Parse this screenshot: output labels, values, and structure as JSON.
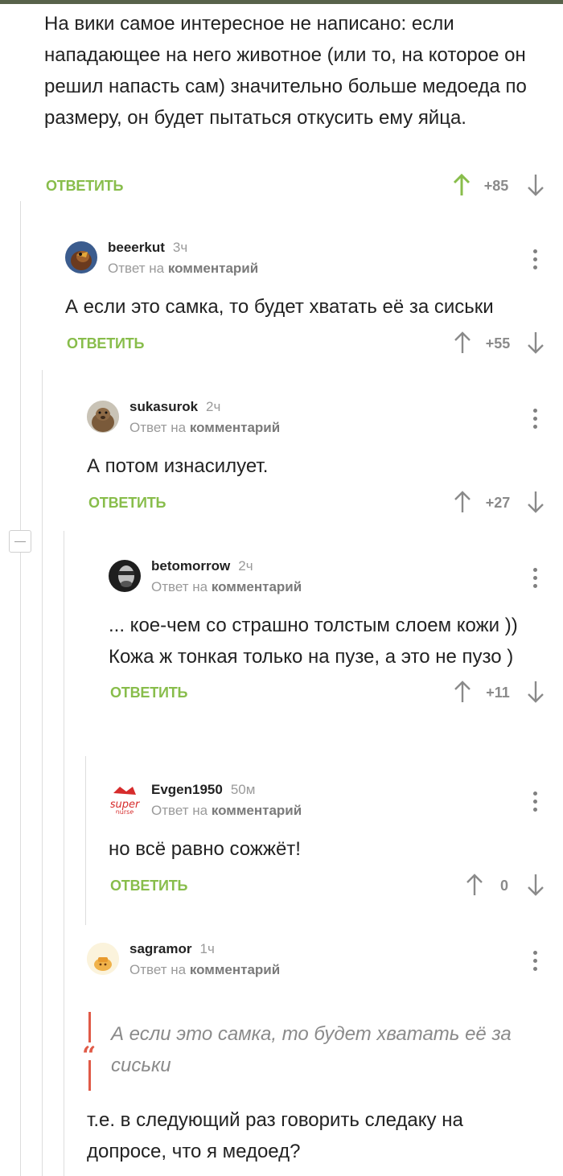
{
  "colors": {
    "accent": "#88bd4b",
    "quote": "#e05a47",
    "meta": "#9a9a9a"
  },
  "labels": {
    "reply_to": "Ответ на",
    "comment_word": "комментарий",
    "reply_button": "ОТВЕТИТЬ"
  },
  "top_comment": {
    "text": "На вики самое интересное не написано:  если нападающее на него животное (или то, на которое он решил напасть сам) значительно больше медоеда по размеру, он будет пытаться откусить ему яйца.",
    "score": "+85"
  },
  "comments": [
    {
      "author": "beeerkut",
      "time": "3ч",
      "text": "А если это самка, то будет хватать её за сиськи",
      "score": "+55",
      "avatar": "bird-avatar"
    },
    {
      "author": "sukasurok",
      "time": "2ч",
      "text": "А потом изнасилует.",
      "score": "+27",
      "avatar": "groundhog-avatar"
    },
    {
      "author": "betomorrow",
      "time": "2ч",
      "text": "... кое-чем со страшно толстым слоем кожи )) Кожа ж тонкая только на пузе, а это не пузо )",
      "score": "+11",
      "avatar": "man-portrait-avatar"
    },
    {
      "author": "Evgen1950",
      "time": "50м",
      "text": "но всё равно сожжёт!",
      "score": "0",
      "avatar": "super-logo-avatar"
    },
    {
      "author": "sagramor",
      "time": "1ч",
      "avatar": "cartoon-avatar",
      "quote": "А если это самка, то будет хватать её за сиськи",
      "text": "т.е. в следующий раз говорить следаку на допросе, что я медоед?"
    }
  ]
}
